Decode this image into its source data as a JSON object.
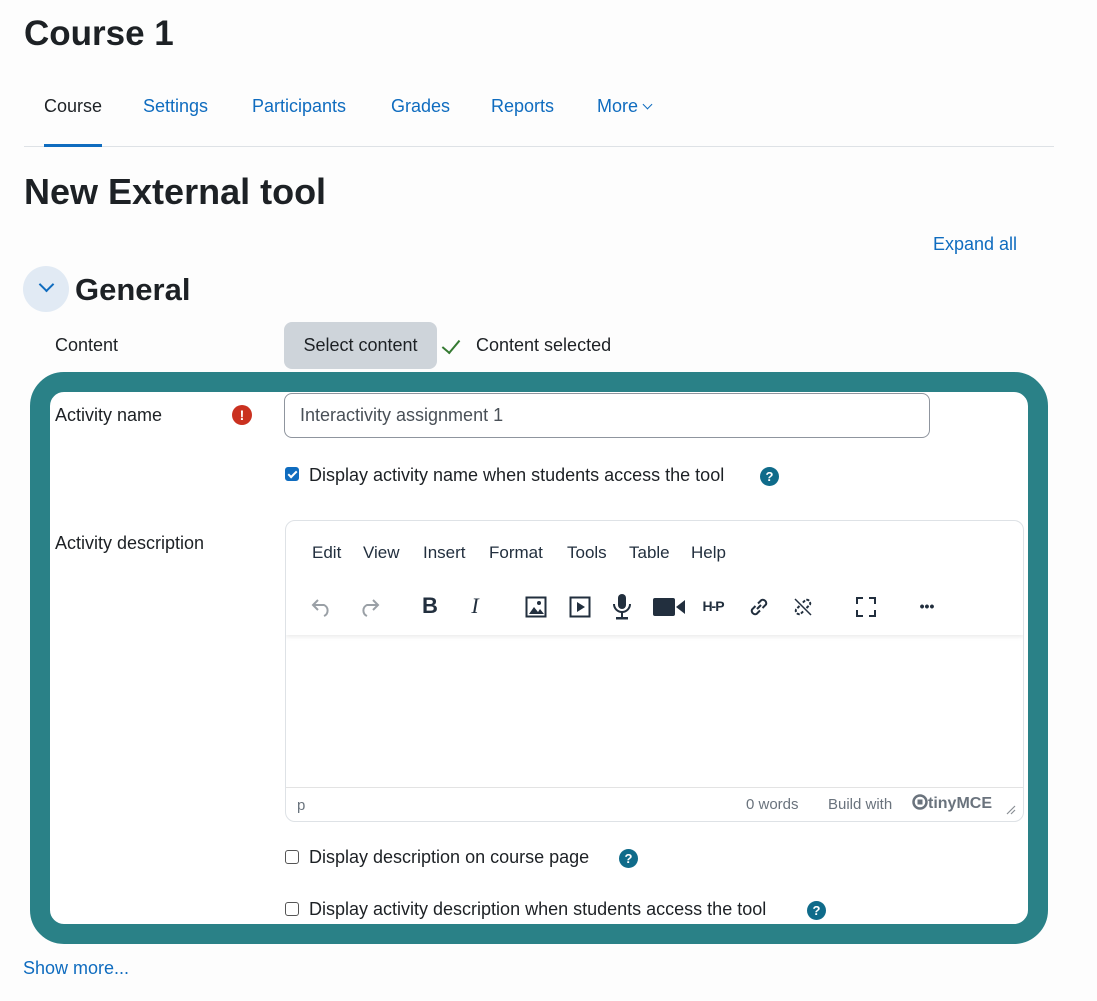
{
  "course": {
    "title": "Course 1"
  },
  "nav": {
    "tabs": [
      {
        "label": "Course",
        "active": true
      },
      {
        "label": "Settings"
      },
      {
        "label": "Participants"
      },
      {
        "label": "Grades"
      },
      {
        "label": "Reports"
      },
      {
        "label": "More"
      }
    ]
  },
  "page": {
    "title": "New External tool",
    "expand_all": "Expand all"
  },
  "section": {
    "title": "General"
  },
  "content": {
    "label": "Content",
    "button": "Select content",
    "status": "Content selected"
  },
  "activity_name": {
    "label": "Activity name",
    "required_icon": "!",
    "value": "Interactivity assignment 1",
    "display_checkbox_label": "Display activity name when students access the tool",
    "display_checked": true
  },
  "activity_description": {
    "label": "Activity description",
    "editor": {
      "menu": [
        "Edit",
        "View",
        "Insert",
        "Format",
        "Tools",
        "Table",
        "Help"
      ],
      "toolbar_icons": [
        "undo-icon",
        "redo-icon",
        "bold-icon",
        "italic-icon",
        "image-icon",
        "media-icon",
        "record-audio-icon",
        "record-video-icon",
        "h5p-icon",
        "link-icon",
        "unlink-icon",
        "fullscreen-icon",
        "more-icon"
      ],
      "bold": "B",
      "italic": "I",
      "h5p": "H-P",
      "more": "•••",
      "status_path": "p",
      "word_count": "0 words",
      "build_with": "Build with",
      "brand": "tinyMCE"
    }
  },
  "options": {
    "display_description": "Display description on course page",
    "display_activity_description": "Display activity description when students access the tool"
  },
  "help_icon": "?",
  "show_more": "Show more...",
  "colors": {
    "accent": "#0f6cbf",
    "frame": "#2a8187",
    "required": "#ca3120",
    "help": "#0f6b8a",
    "success": "#357a32"
  }
}
